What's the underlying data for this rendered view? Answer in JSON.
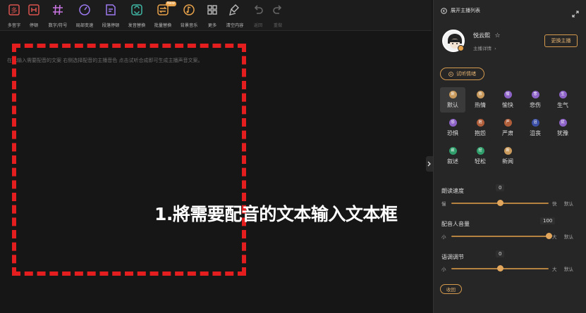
{
  "toolbar": {
    "items": [
      {
        "label": "多音字",
        "icon": "polyphone-icon",
        "color": "#d9534f"
      },
      {
        "label": "停顿",
        "icon": "pause-icon",
        "color": "#d9534f"
      },
      {
        "label": "数字/符号",
        "icon": "number-symbol-icon",
        "color": "#c874e0"
      },
      {
        "label": "局部变速",
        "icon": "speed-icon",
        "color": "#9b79ee"
      },
      {
        "label": "段落停顿",
        "icon": "paragraph-pause-icon",
        "color": "#9b79ee"
      },
      {
        "label": "发音替换",
        "icon": "pronunciation-replace-icon",
        "color": "#3fb7a5"
      },
      {
        "label": "批量替换",
        "icon": "batch-replace-icon",
        "color": "#e8a24a",
        "badge": "New"
      },
      {
        "label": "背景音乐",
        "icon": "music-icon",
        "color": "#e8a24a"
      },
      {
        "label": "更多",
        "icon": "more-grid-icon",
        "color": "#bbbbbb"
      },
      {
        "label": "清空内容",
        "icon": "clear-icon",
        "color": "#bbbbbb"
      },
      {
        "label": "返回",
        "icon": "undo-icon",
        "color": "#666666"
      },
      {
        "label": "重做",
        "icon": "redo-icon",
        "color": "#666666"
      }
    ]
  },
  "editor": {
    "placeholder": "在此输入需要配音的文案 右侧选择配音的主播音色 点击试听合成即可生成主播声音文案。",
    "instruction": "1.將需要配音的文本输入文本框"
  },
  "panel": {
    "header": "展开主播列表",
    "anchor": {
      "name": "悦云熙",
      "detail": "主播详情"
    },
    "switch_label": "更换主播",
    "listen_label": "试听情绪",
    "emotions": [
      {
        "label": "默认",
        "glyph": "默",
        "color": "#c99a5c",
        "selected": true
      },
      {
        "label": "热情",
        "glyph": "热",
        "color": "#c99a5c"
      },
      {
        "label": "愉快",
        "glyph": "愉",
        "color": "#8e63c8"
      },
      {
        "label": "悲伤",
        "glyph": "悲",
        "color": "#8e63c8"
      },
      {
        "label": "生气",
        "glyph": "生",
        "color": "#8e63c8"
      },
      {
        "label": "恐惧",
        "glyph": "恐",
        "color": "#8e63c8"
      },
      {
        "label": "抱怨",
        "glyph": "抱",
        "color": "#b05d3a"
      },
      {
        "label": "严肃",
        "glyph": "严",
        "color": "#b05d3a"
      },
      {
        "label": "沮丧",
        "glyph": "沮",
        "color": "#3b4fa6"
      },
      {
        "label": "犹豫",
        "glyph": "犹",
        "color": "#8e63c8"
      },
      {
        "label": "叙述",
        "glyph": "叙",
        "color": "#2f9d6a"
      },
      {
        "label": "轻松",
        "glyph": "轻",
        "color": "#2f9d6a"
      },
      {
        "label": "新闻",
        "glyph": "新",
        "color": "#c99a5c"
      }
    ],
    "sliders": [
      {
        "label": "朗读速度",
        "value": "0",
        "min": "慢",
        "max": "快",
        "default": "默认",
        "fraction": 0.5
      },
      {
        "label": "配音人音量",
        "value": "100",
        "min": "小",
        "max": "大",
        "default": "默认",
        "fraction": 1.0
      },
      {
        "label": "语调调节",
        "value": "0",
        "min": "小",
        "max": "大",
        "default": "默认",
        "fraction": 0.5
      }
    ],
    "collapse_label": "收回"
  }
}
